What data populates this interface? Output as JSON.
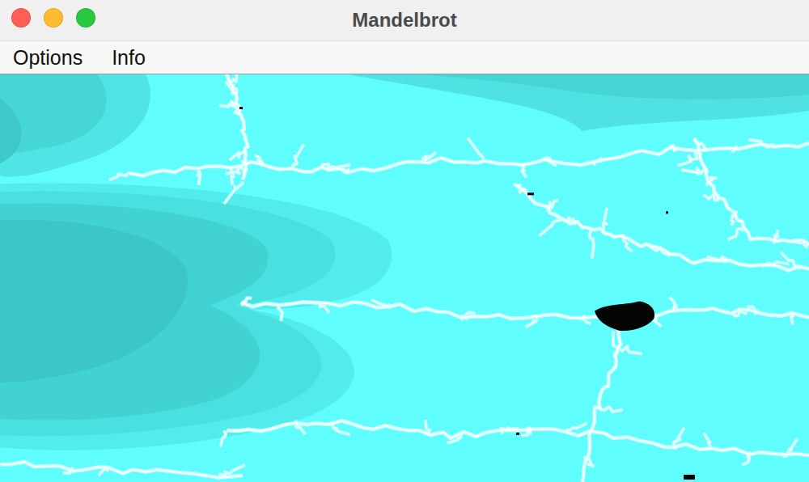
{
  "window": {
    "title": "Mandelbrot"
  },
  "menu": [
    {
      "label": "Options"
    },
    {
      "label": "Info"
    }
  ]
}
